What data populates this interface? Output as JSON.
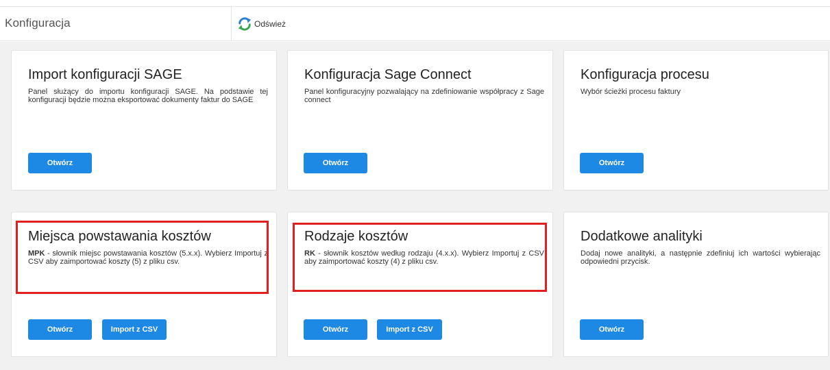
{
  "header": {
    "title": "Konfiguracja",
    "refresh_label": "Odśwież"
  },
  "cards": [
    {
      "title": "Import konfiguracji SAGE",
      "desc_bold": "",
      "desc": "Panel służący do importu konfiguracji SAGE. Na podstawie tej konfiguracji będzie można eksportować dokumenty faktur do SAGE",
      "open_label": "Otwórz"
    },
    {
      "title": "Konfiguracja Sage Connect",
      "desc_bold": "",
      "desc": "Panel konfiguracyjny pozwalający na zdefiniowanie współpracy z Sage connect",
      "open_label": "Otwórz"
    },
    {
      "title": "Konfiguracja procesu",
      "desc_bold": "",
      "desc": "Wybór ścieżki procesu faktury",
      "open_label": "Otwórz"
    },
    {
      "title": "Miejsca powstawania kosztów",
      "desc_bold": "MPK",
      "desc": " - słownik miejsc powstawania kosztów (5.x.x). Wybierz Importuj z CSV aby zaimportować koszty (5) z pliku csv.",
      "open_label": "Otwórz",
      "import_label": "Import z CSV"
    },
    {
      "title": "Rodzaje kosztów",
      "desc_bold": "RK",
      "desc": " - słownik kosztów według rodzaju (4.x.x). Wybierz Importuj z CSV aby zaimportować koszty (4) z pliku csv.",
      "open_label": "Otwórz",
      "import_label": "Import z CSV"
    },
    {
      "title": "Dodatkowe analityki",
      "desc_bold": "",
      "desc": "Dodaj nowe analityki, a następnie zdefiniuj ich wartości wybierając odpowiedni przycisk.",
      "open_label": "Otwórz"
    }
  ],
  "colors": {
    "button": "#1e88e5",
    "highlight": "#e02020",
    "background": "#f1f1f1"
  },
  "icons": {
    "refresh": "refresh-icon"
  }
}
